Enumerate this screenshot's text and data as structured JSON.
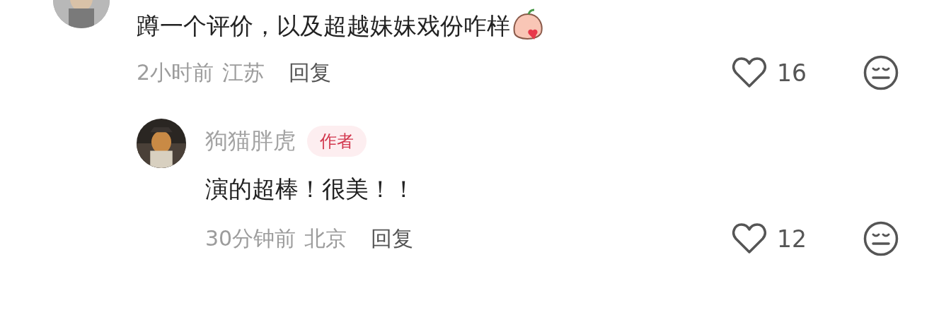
{
  "comments": [
    {
      "text": "蹲一个评价，以及超越妹妹戏份咋样",
      "sticker": true,
      "time": "2小时前",
      "location": "江苏",
      "reply_label": "回复",
      "likes": "16",
      "replies": [
        {
          "author": "狗猫胖虎",
          "badge": "作者",
          "text": "演的超棒！很美！！",
          "time": "30分钟前",
          "location": "北京",
          "reply_label": "回复",
          "likes": "12"
        }
      ]
    }
  ]
}
